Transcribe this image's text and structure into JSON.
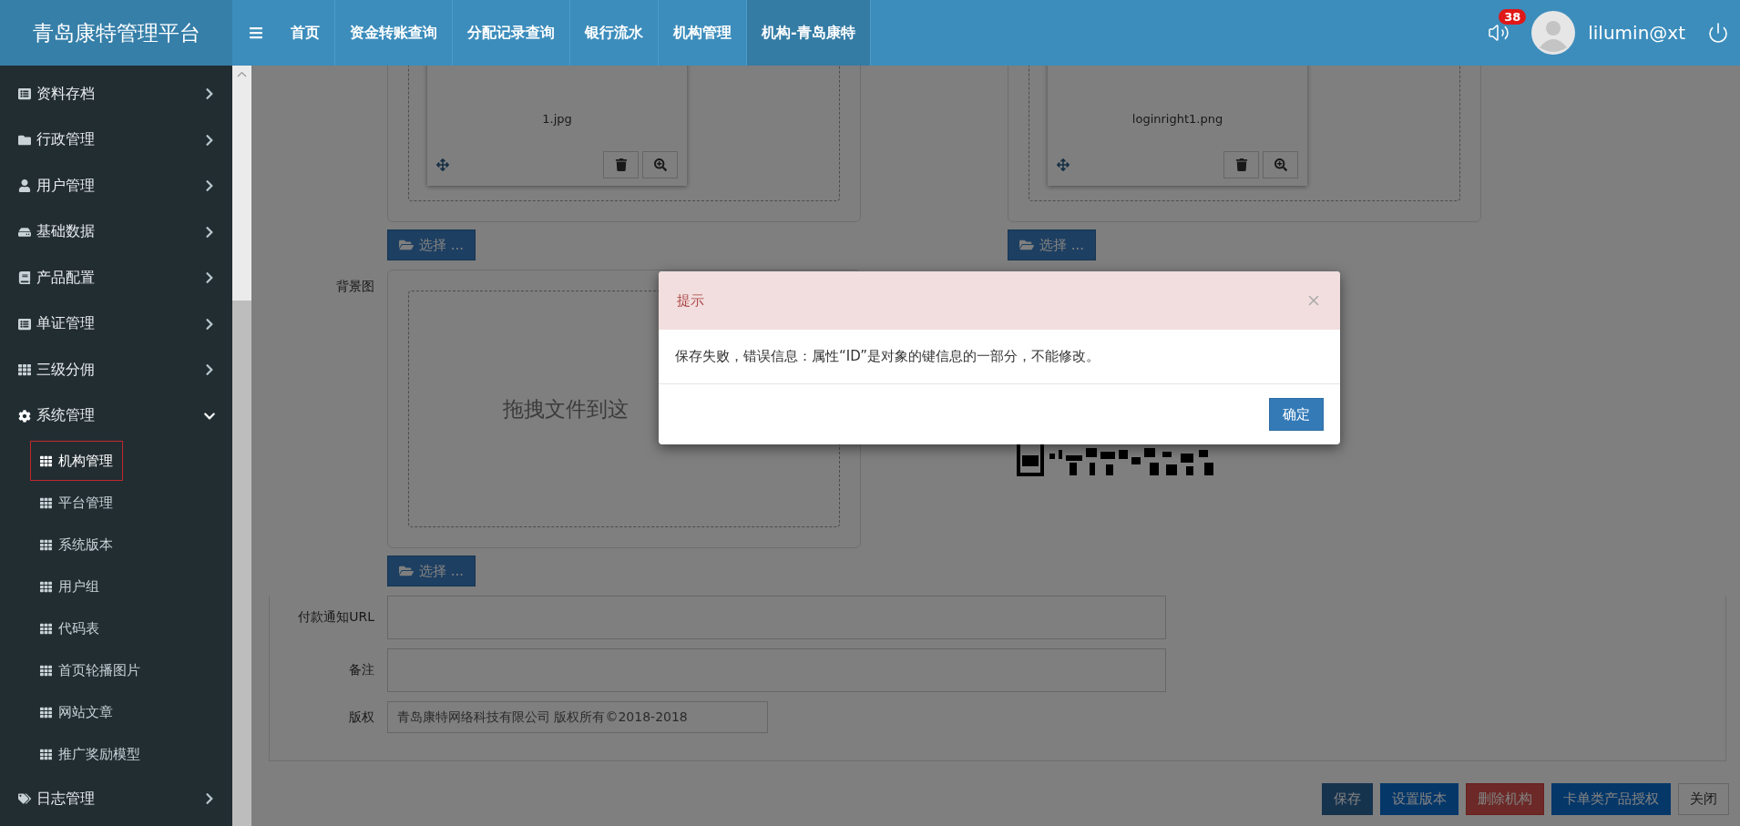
{
  "brand": "青岛康特管理平台",
  "nav": [
    {
      "label": "首页",
      "selected": false
    },
    {
      "label": "资金转账查询",
      "selected": false
    },
    {
      "label": "分配记录查询",
      "selected": false
    },
    {
      "label": "银行流水",
      "selected": false
    },
    {
      "label": "机构管理",
      "selected": false
    },
    {
      "label": "机构-青岛康特",
      "selected": true
    }
  ],
  "user": {
    "notifications": "38",
    "name": "lilumin@xt"
  },
  "sidebar": {
    "items": [
      {
        "label": "资料存档",
        "kind": "list",
        "expanded": false
      },
      {
        "label": "行政管理",
        "kind": "folder",
        "expanded": false
      },
      {
        "label": "用户管理",
        "kind": "user",
        "expanded": false
      },
      {
        "label": "基础数据",
        "kind": "drive",
        "expanded": false
      },
      {
        "label": "产品配置",
        "kind": "book",
        "expanded": false
      },
      {
        "label": "单证管理",
        "kind": "list",
        "expanded": false
      },
      {
        "label": "三级分佣",
        "kind": "grid",
        "expanded": false
      },
      {
        "label": "系统管理",
        "kind": "gear",
        "expanded": true,
        "children": [
          {
            "label": "机构管理",
            "selected": true
          },
          {
            "label": "平台管理",
            "selected": false
          },
          {
            "label": "系统版本",
            "selected": false
          },
          {
            "label": "用户组",
            "selected": false
          },
          {
            "label": "代码表",
            "selected": false
          },
          {
            "label": "首页轮播图片",
            "selected": false
          },
          {
            "label": "网站文章",
            "selected": false
          },
          {
            "label": "推广奖励模型",
            "selected": false
          }
        ]
      },
      {
        "label": "日志管理",
        "kind": "tag",
        "expanded": false
      }
    ]
  },
  "form": {
    "image_uploads": [
      {
        "file": "1.jpg",
        "button": "选择 ..."
      },
      {
        "file": "loginright1.png",
        "button": "选择 ..."
      }
    ],
    "background": {
      "label": "背景图",
      "dropzone": "拖拽文件到这",
      "button": "选择 ..."
    },
    "fields": [
      {
        "label": "付款通知URL",
        "kind": "wide"
      },
      {
        "label": "备注",
        "kind": "wide"
      },
      {
        "label": "版权",
        "kind": "short",
        "value": "青岛康特网络科技有限公司 版权所有©2018-2018"
      }
    ]
  },
  "actions": [
    {
      "label": "保存",
      "kind": "save"
    },
    {
      "label": "设置版本",
      "kind": "primary"
    },
    {
      "label": "删除机构",
      "kind": "danger"
    },
    {
      "label": "卡单类产品授权",
      "kind": "primary"
    },
    {
      "label": "关闭",
      "kind": "default"
    }
  ],
  "dialog": {
    "title": "提示",
    "message": "保存失败，错误信息：属性“ID”是对象的键信息的一部分，不能修改。",
    "button": "确定"
  }
}
